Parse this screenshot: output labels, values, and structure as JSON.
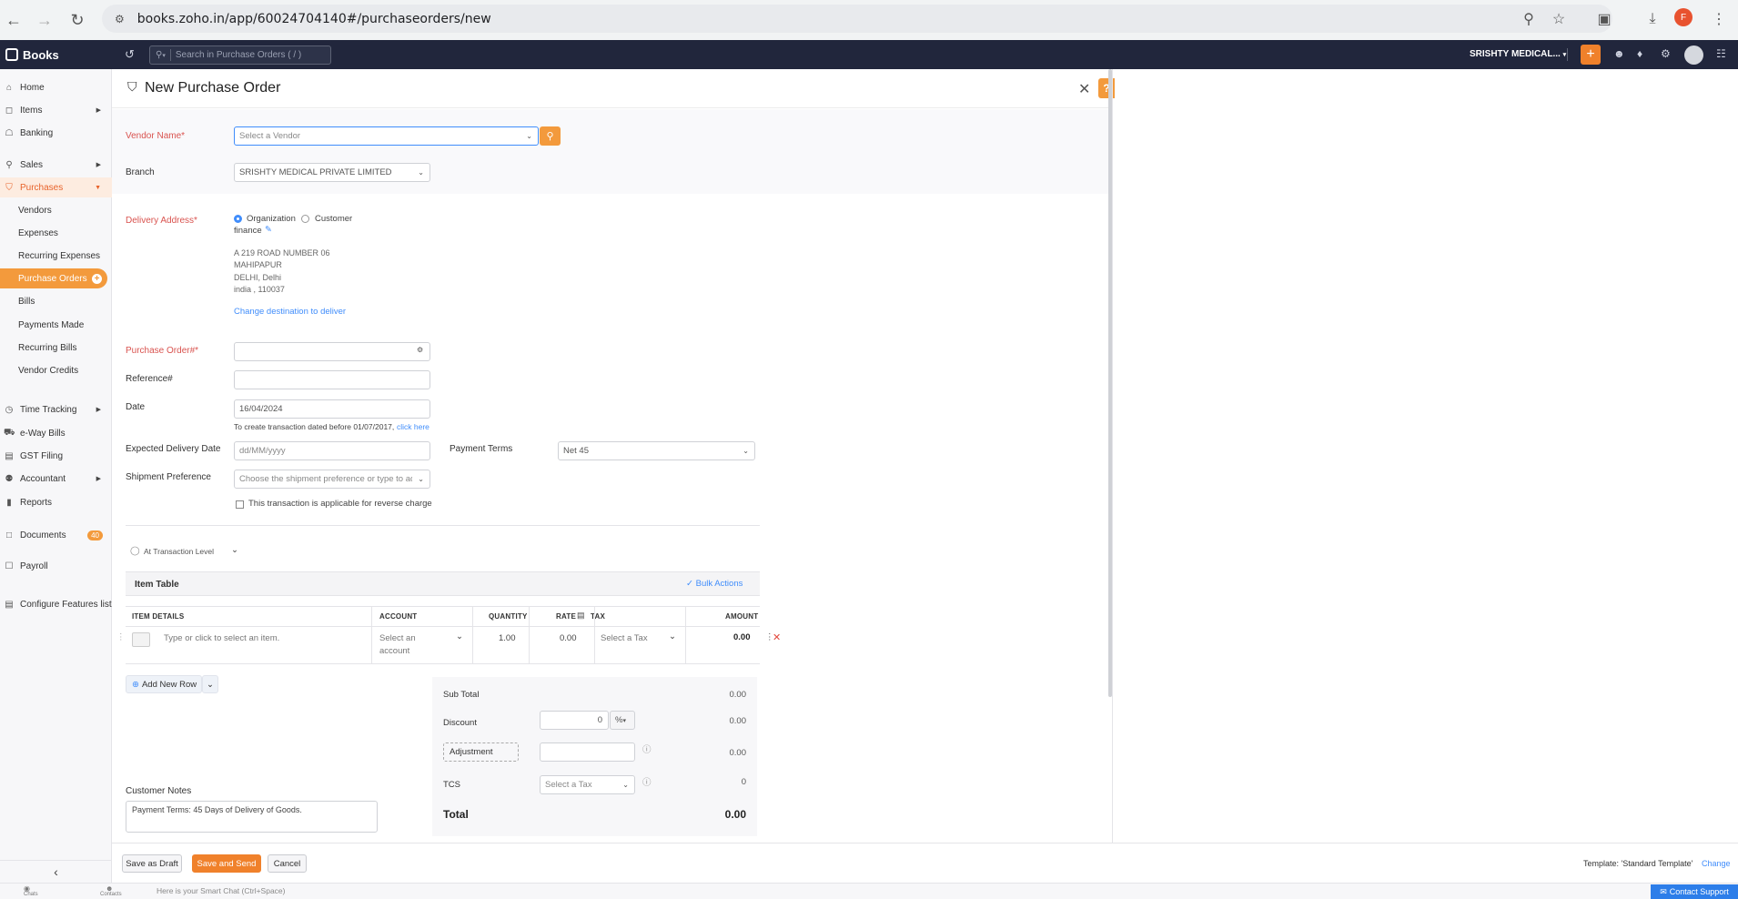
{
  "browser": {
    "url": "books.zoho.in/app/60024704140#/purchaseorders/new",
    "profile_initial": "F"
  },
  "app": {
    "brand": "Books",
    "search_placeholder": "Search in Purchase Orders ( / )",
    "org_name": "SRISHTY MEDICAL...",
    "accent_color": "#f0812b",
    "link_color": "#408dfb"
  },
  "sidebar": {
    "items": {
      "home": "Home",
      "items": "Items",
      "banking": "Banking",
      "sales": "Sales",
      "purchases": "Purchases",
      "time_tracking": "Time Tracking",
      "eway_bills": "e-Way Bills",
      "gst_filing": "GST Filing",
      "accountant": "Accountant",
      "reports": "Reports",
      "documents": "Documents",
      "documents_badge": "40",
      "payroll": "Payroll",
      "configure": "Configure Features list"
    },
    "purchases_sub": {
      "vendors": "Vendors",
      "expenses": "Expenses",
      "recurring_expenses": "Recurring Expenses",
      "purchase_orders": "Purchase Orders",
      "bills": "Bills",
      "payments_made": "Payments Made",
      "recurring_bills": "Recurring Bills",
      "vendor_credits": "Vendor Credits"
    }
  },
  "form": {
    "title": "New Purchase Order",
    "vendor_label": "Vendor Name*",
    "vendor_placeholder": "Select a Vendor",
    "branch_label": "Branch",
    "branch_value": "SRISHTY MEDICAL PRIVATE LIMITED",
    "delivery_label": "Delivery Address*",
    "opt_org": "Organization",
    "opt_customer": "Customer",
    "address_name": "finance",
    "address_line1": "A 219 ROAD NUMBER 06",
    "address_line2": "MAHIPAPUR",
    "address_line3": "DELHI, Delhi",
    "address_line4": "india , 110037",
    "change_dest": "Change destination to deliver",
    "po_label": "Purchase Order#*",
    "po_value": "",
    "ref_label": "Reference#",
    "ref_value": "",
    "date_label": "Date",
    "date_value": "16/04/2024",
    "date_note": "To create transaction dated before 01/07/2017,",
    "date_note_link": "click here",
    "exp_delivery_label": "Expected Delivery Date",
    "exp_delivery_placeholder": "dd/MM/yyyy",
    "payment_terms_label": "Payment Terms",
    "payment_terms_value": "Net 45",
    "shipment_label": "Shipment Preference",
    "shipment_placeholder": "Choose the shipment preference or type to ad",
    "reverse_charge": "This transaction is applicable for reverse charge",
    "tax_level": "At Transaction Level"
  },
  "item_table": {
    "title": "Item Table",
    "bulk_actions": "Bulk Actions",
    "columns": {
      "details": "ITEM DETAILS",
      "account": "ACCOUNT",
      "quantity": "QUANTITY",
      "rate": "RATE",
      "tax": "TAX",
      "amount": "AMOUNT"
    },
    "row": {
      "item_placeholder": "Type or click to select an item.",
      "account_placeholder_1": "Select an",
      "account_placeholder_2": "account",
      "quantity": "1.00",
      "rate": "0.00",
      "tax_placeholder": "Select a Tax",
      "amount": "0.00"
    },
    "add_row": "Add New Row"
  },
  "totals": {
    "subtotal_label": "Sub Total",
    "subtotal_value": "0.00",
    "discount_label": "Discount",
    "discount_input": "0",
    "discount_unit": "%",
    "discount_value": "0.00",
    "adjustment_label": "Adjustment",
    "adjustment_value": "0.00",
    "tcs_label": "TCS",
    "tcs_placeholder": "Select a Tax",
    "tcs_value": "0",
    "total_label": "Total",
    "total_value": "0.00"
  },
  "notes": {
    "label": "Customer Notes",
    "value": "Payment Terms: 45 Days of Delivery of Goods."
  },
  "footer": {
    "save_draft": "Save as Draft",
    "save_send": "Save and Send",
    "cancel": "Cancel",
    "template_label": "Template:",
    "template_name": "'Standard Template'",
    "template_change": "Change"
  },
  "chat": {
    "chats": "Chats",
    "contacts": "Contacts",
    "placeholder": "Here is your Smart Chat (Ctrl+Space)",
    "contact_support": "Contact Support"
  }
}
